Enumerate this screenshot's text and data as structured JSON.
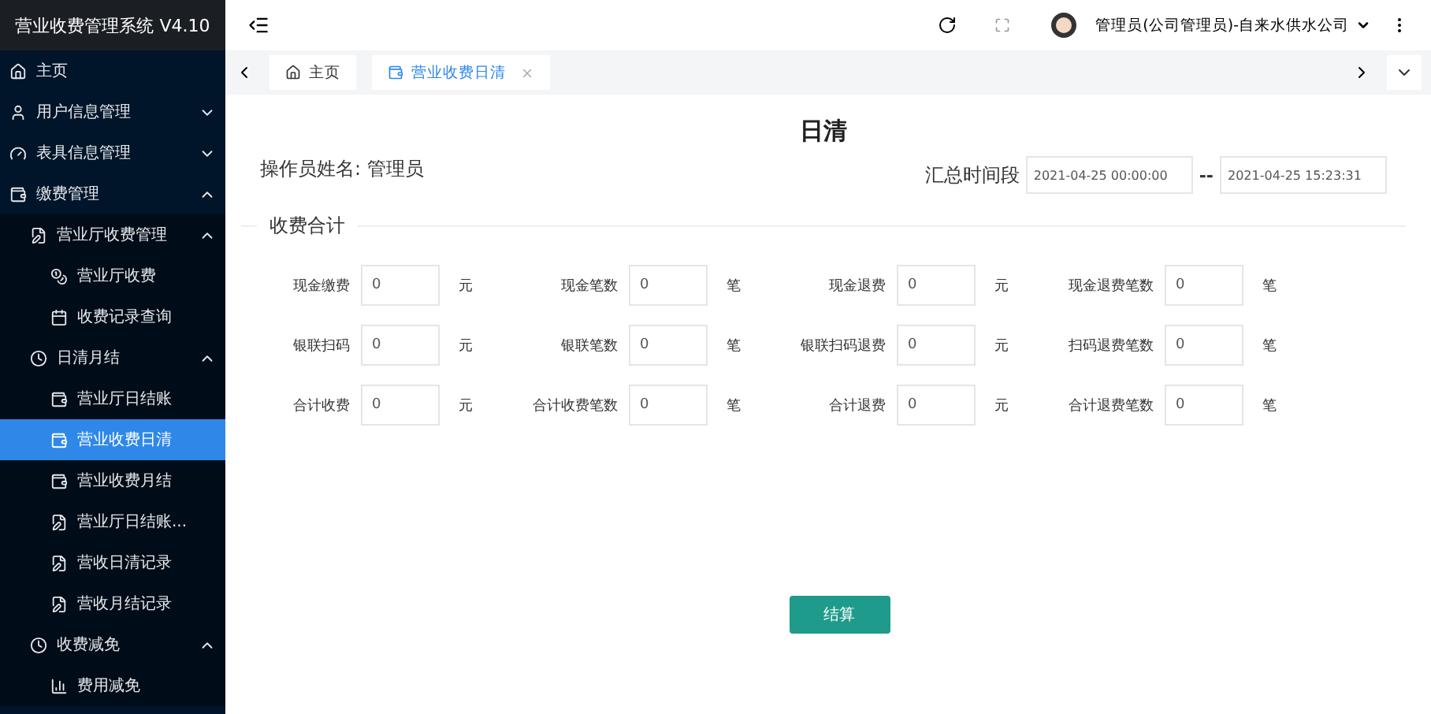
{
  "app_title": "营业收费管理系统 V4.10",
  "sidebar": {
    "items": [
      {
        "label": "主页",
        "selected": false
      },
      {
        "label": "用户信息管理",
        "selected": false,
        "expanded": false
      },
      {
        "label": "表具信息管理",
        "selected": false,
        "expanded": false
      },
      {
        "label": "缴费管理",
        "selected": false,
        "expanded": true,
        "children": [
          {
            "label": "营业厅收费管理",
            "selected": false,
            "expanded": true,
            "children": [
              {
                "label": "营业厅收费",
                "selected": false
              },
              {
                "label": "收费记录查询",
                "selected": false
              }
            ]
          },
          {
            "label": "日清月结",
            "selected": false,
            "expanded": true,
            "children": [
              {
                "label": "营业厅日结账",
                "selected": false
              },
              {
                "label": "营业收费日清",
                "selected": true
              },
              {
                "label": "营业收费月结",
                "selected": false
              },
              {
                "label": "营业厅日结账...",
                "selected": false
              },
              {
                "label": "营收日清记录",
                "selected": false
              },
              {
                "label": "营收月结记录",
                "selected": false
              }
            ]
          },
          {
            "label": "收费减免",
            "selected": false,
            "expanded": true,
            "children": [
              {
                "label": "费用减免",
                "selected": false
              }
            ]
          }
        ]
      }
    ]
  },
  "header": {
    "user": "管理员(公司管理员)-自来水供水公司"
  },
  "tabs": [
    {
      "label": "主页",
      "selected": false
    },
    {
      "label": "营业收费日清",
      "selected": true
    }
  ],
  "page": {
    "title": "日清",
    "operator": "操作员姓名: 管理员",
    "period_label": "汇总时间段",
    "period_start": "2021-04-25 00:00:00",
    "period_separator": "--",
    "period_end": "2021-04-25 15:23:31",
    "section": "收费合计",
    "fields": [
      [
        {
          "label": "现金缴费",
          "value": "0",
          "unit": "元"
        },
        {
          "label": "现金笔数",
          "value": "0",
          "unit": "笔"
        },
        {
          "label": "现金退费",
          "value": "0",
          "unit": "元"
        },
        {
          "label": "现金退费笔数",
          "value": "0",
          "unit": "笔"
        }
      ],
      [
        {
          "label": "银联扫码",
          "value": "0",
          "unit": "元"
        },
        {
          "label": "银联笔数",
          "value": "0",
          "unit": "笔"
        },
        {
          "label": "银联扫码退费",
          "value": "0",
          "unit": "元"
        },
        {
          "label": "扫码退费笔数",
          "value": "0",
          "unit": "笔"
        }
      ],
      [
        {
          "label": "合计收费",
          "value": "0",
          "unit": "元"
        },
        {
          "label": "合计收费笔数",
          "value": "0",
          "unit": "笔"
        },
        {
          "label": "合计退费",
          "value": "0",
          "unit": "元"
        },
        {
          "label": "合计退费笔数",
          "value": "0",
          "unit": "笔"
        }
      ]
    ],
    "submit": "结算"
  }
}
